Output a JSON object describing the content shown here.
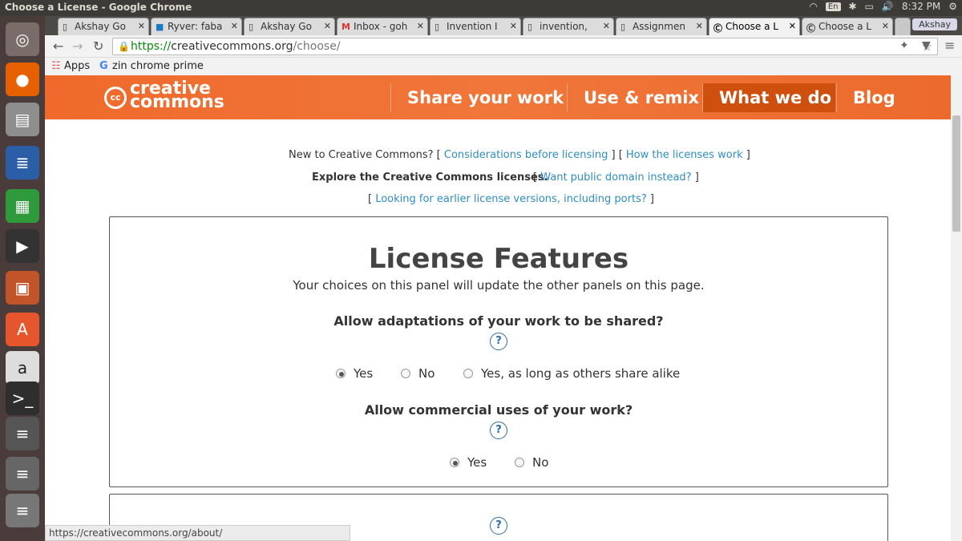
{
  "window": {
    "title": "Choose a License - Google Chrome"
  },
  "panel_indicators": {
    "keyboard": "En",
    "time": "8:32 PM",
    "user": "Akshay"
  },
  "tabs": [
    {
      "label": "Akshay Go",
      "icon": "doc-icon"
    },
    {
      "label": "Ryver: faba",
      "icon": "ryver-icon"
    },
    {
      "label": "Akshay Go",
      "icon": "doc-icon"
    },
    {
      "label": "Inbox - goh",
      "icon": "gmail-icon"
    },
    {
      "label": "Invention I",
      "icon": "doc-icon"
    },
    {
      "label": "invention,",
      "icon": "doc-icon"
    },
    {
      "label": "Assignmen",
      "icon": "doc-icon"
    },
    {
      "label": "Choose a L",
      "icon": "cc-icon"
    },
    {
      "label": "Choose a L",
      "icon": "cc-icon"
    }
  ],
  "profile": {
    "label": "Akshay"
  },
  "omnibox": {
    "scheme": "https://",
    "host": "creativecommons.org",
    "path": "/choose/"
  },
  "bookmarks": {
    "apps": "Apps",
    "item1": "zin chrome prime"
  },
  "cc": {
    "logo_line1": "creative",
    "logo_line2": "commons",
    "logo_cc": "cc",
    "nav": [
      "Share your work",
      "Use & remix",
      "What we do",
      "Blog"
    ]
  },
  "intro": {
    "new_to": "New to Creative Commons?",
    "link_considerations": "Considerations before licensing",
    "link_how": "How the licenses work",
    "explore": "Explore the Creative Commons licenses.",
    "link_public_domain": "Want public domain instead?",
    "link_earlier": "Looking for earlier license versions, including ports?"
  },
  "license_features": {
    "title": "License Features",
    "subtitle": "Your choices on this panel will update the other panels on this page.",
    "q1": "Allow adaptations of your work to be shared?",
    "q1_options": [
      "Yes",
      "No",
      "Yes, as long as others share alike"
    ],
    "q1_selected": "Yes",
    "q2": "Allow commercial uses of your work?",
    "q2_options": [
      "Yes",
      "No"
    ],
    "q2_selected": "Yes",
    "help_glyph": "?"
  },
  "status": {
    "url": "https://creativecommons.org/about/"
  }
}
